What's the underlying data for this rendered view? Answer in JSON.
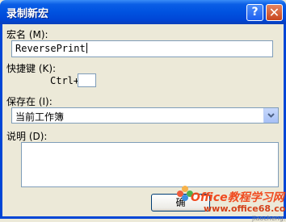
{
  "window": {
    "title": "录制新宏",
    "help_glyph": "?",
    "close_glyph": "✕"
  },
  "form": {
    "macro_name_label": "宏名 (M):",
    "macro_name_value": "ReversePrint",
    "shortcut_label": "快捷键 (K):",
    "shortcut_prefix": "Ctrl+",
    "shortcut_value": "",
    "store_in_label": "保存在 (I):",
    "store_in_value": "当前工作簿",
    "description_label": "说明 (D):",
    "description_value": ""
  },
  "buttons": {
    "ok_label": "确"
  },
  "watermark": {
    "brand": "Office教程学习网",
    "url": "www.office68.com",
    "sub": "jiaocheng.com"
  }
}
